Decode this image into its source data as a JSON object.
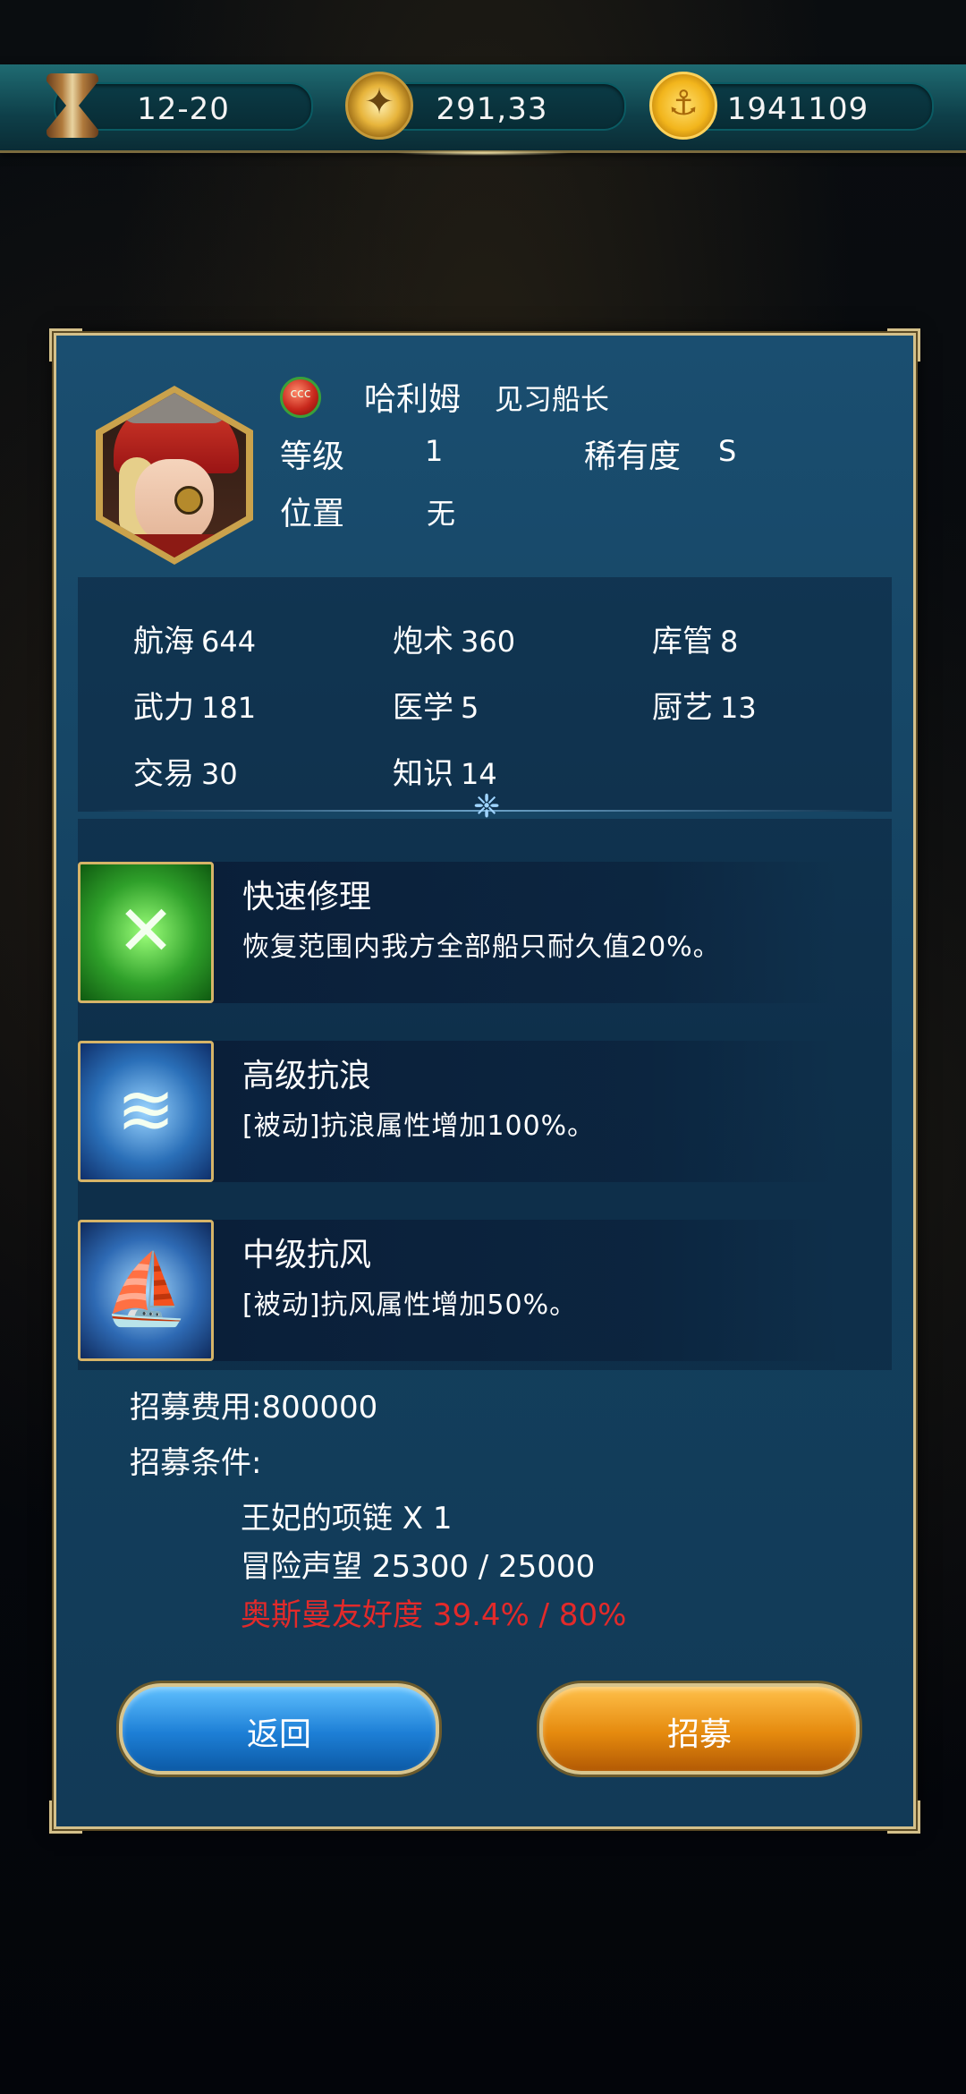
{
  "topbar": {
    "date": "12-20",
    "compass_value": "291,33",
    "gold": "1941109"
  },
  "captain": {
    "name": "哈利姆",
    "title": "见习船长",
    "gem_label": "ccc",
    "level_label": "等级",
    "level": "1",
    "rarity_label": "稀有度",
    "rarity": "S",
    "position_label": "位置",
    "position": "无"
  },
  "stats": [
    {
      "label": "航海",
      "value": "644"
    },
    {
      "label": "炮术",
      "value": "360"
    },
    {
      "label": "库管",
      "value": "8"
    },
    {
      "label": "武力",
      "value": "181"
    },
    {
      "label": "医学",
      "value": "5"
    },
    {
      "label": "厨艺",
      "value": "13"
    },
    {
      "label": "交易",
      "value": "30"
    },
    {
      "label": "知识",
      "value": "14"
    }
  ],
  "skills": [
    {
      "name": "快速修理",
      "desc": "恢复范围内我方全部船只耐久值20%。",
      "icon": "repair-icon"
    },
    {
      "name": "高级抗浪",
      "desc": "[被动]抗浪属性增加100%。",
      "icon": "wave-icon"
    },
    {
      "name": "中级抗风",
      "desc": "[被动]抗风属性增加50%。",
      "icon": "wind-sail-icon"
    }
  ],
  "recruit": {
    "cost_label": "招募费用:",
    "cost": "800000",
    "conditions_label": "招募条件:",
    "conditions": [
      {
        "text": "王妃的项链 X 1",
        "met": true
      },
      {
        "text": "冒险声望 25300 / 25000",
        "met": true
      },
      {
        "text": "奥斯曼友好度 39.4% / 80%",
        "met": false
      }
    ]
  },
  "buttons": {
    "back": "返回",
    "recruit": "招募"
  },
  "colors": {
    "unmet_condition": "#e32a2a",
    "panel_border": "#d4c08a"
  }
}
